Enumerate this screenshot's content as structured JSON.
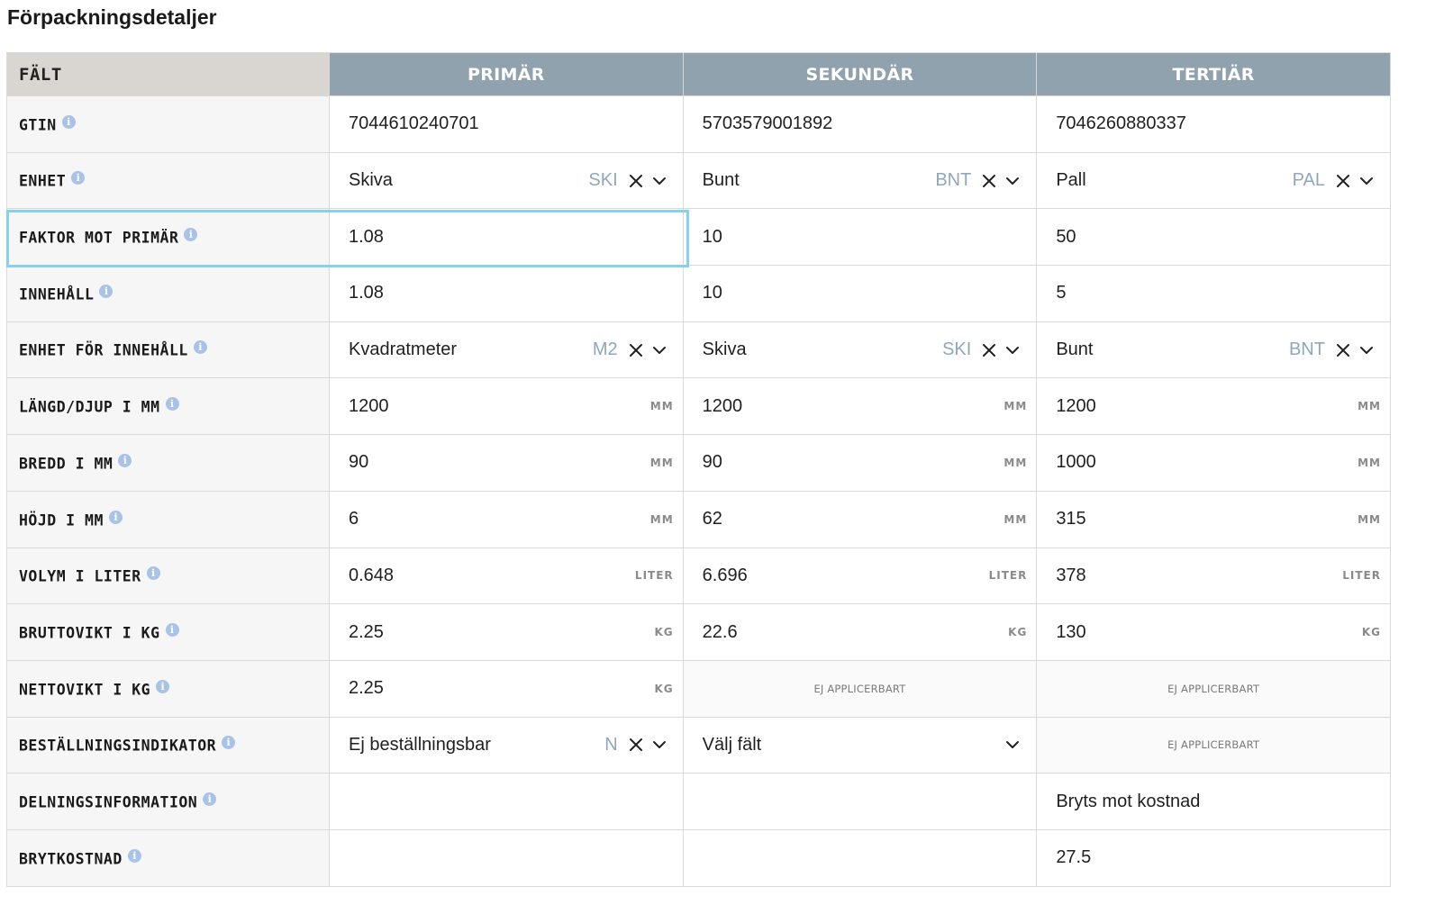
{
  "page_title": "Förpackningsdetaljer",
  "headers": {
    "field": "FÄLT",
    "primary": "PRIMÄR",
    "secondary": "SEKUNDÄR",
    "tertiary": "TERTIÄR"
  },
  "rows": [
    {
      "label": "GTIN",
      "cells": [
        {
          "kind": "text",
          "value": "7044610240701"
        },
        {
          "kind": "text",
          "value": "5703579001892"
        },
        {
          "kind": "text",
          "value": "7046260880337"
        }
      ]
    },
    {
      "label": "ENHET",
      "cells": [
        {
          "kind": "select",
          "value": "Skiva",
          "code": "SKI"
        },
        {
          "kind": "select",
          "value": "Bunt",
          "code": "BNT"
        },
        {
          "kind": "select",
          "value": "Pall",
          "code": "PAL"
        }
      ]
    },
    {
      "label": "FAKTOR MOT PRIMÄR",
      "cells": [
        {
          "kind": "text",
          "value": "1.08"
        },
        {
          "kind": "text",
          "value": "10"
        },
        {
          "kind": "text",
          "value": "50"
        }
      ]
    },
    {
      "label": "INNEHÅLL",
      "cells": [
        {
          "kind": "text",
          "value": "1.08"
        },
        {
          "kind": "text",
          "value": "10"
        },
        {
          "kind": "text",
          "value": "5"
        }
      ]
    },
    {
      "label": "ENHET FÖR INNEHÅLL",
      "cells": [
        {
          "kind": "select",
          "value": "Kvadratmeter",
          "code": "M2"
        },
        {
          "kind": "select",
          "value": "Skiva",
          "code": "SKI"
        },
        {
          "kind": "select",
          "value": "Bunt",
          "code": "BNT"
        }
      ]
    },
    {
      "label": "LÄNGD/DJUP I MM",
      "cells": [
        {
          "kind": "unit",
          "value": "1200",
          "unit": "MM"
        },
        {
          "kind": "unit",
          "value": "1200",
          "unit": "MM"
        },
        {
          "kind": "unit",
          "value": "1200",
          "unit": "MM"
        }
      ]
    },
    {
      "label": "BREDD I MM",
      "cells": [
        {
          "kind": "unit",
          "value": "90",
          "unit": "MM"
        },
        {
          "kind": "unit",
          "value": "90",
          "unit": "MM"
        },
        {
          "kind": "unit",
          "value": "1000",
          "unit": "MM"
        }
      ]
    },
    {
      "label": "HÖJD I MM",
      "cells": [
        {
          "kind": "unit",
          "value": "6",
          "unit": "MM"
        },
        {
          "kind": "unit",
          "value": "62",
          "unit": "MM"
        },
        {
          "kind": "unit",
          "value": "315",
          "unit": "MM"
        }
      ]
    },
    {
      "label": "VOLYM I LITER",
      "cells": [
        {
          "kind": "unit",
          "value": "0.648",
          "unit": "LITER"
        },
        {
          "kind": "unit",
          "value": "6.696",
          "unit": "LITER"
        },
        {
          "kind": "unit",
          "value": "378",
          "unit": "LITER"
        }
      ]
    },
    {
      "label": "BRUTTOVIKT I KG",
      "cells": [
        {
          "kind": "unit",
          "value": "2.25",
          "unit": "KG"
        },
        {
          "kind": "unit",
          "value": "22.6",
          "unit": "KG"
        },
        {
          "kind": "unit",
          "value": "130",
          "unit": "KG"
        }
      ]
    },
    {
      "label": "NETTOVIKT I KG",
      "cells": [
        {
          "kind": "unit",
          "value": "2.25",
          "unit": "KG"
        },
        {
          "kind": "na",
          "value": "EJ APPLICERBART"
        },
        {
          "kind": "na",
          "value": "EJ APPLICERBART"
        }
      ]
    },
    {
      "label": "BESTÄLLNINGSINDIKATOR",
      "cells": [
        {
          "kind": "select",
          "value": "Ej beställningsbar",
          "code": "N"
        },
        {
          "kind": "placeholder",
          "value": "Välj fält"
        },
        {
          "kind": "na",
          "value": "EJ APPLICERBART"
        }
      ]
    },
    {
      "label": "DELNINGSINFORMATION",
      "cells": [
        {
          "kind": "empty"
        },
        {
          "kind": "empty"
        },
        {
          "kind": "text",
          "value": "Bryts mot kostnad"
        }
      ]
    },
    {
      "label": "BRYTKOSTNAD",
      "cells": [
        {
          "kind": "empty"
        },
        {
          "kind": "empty"
        },
        {
          "kind": "text",
          "value": "27.5"
        }
      ]
    }
  ],
  "colors": {
    "header_blue": "#8fa2ad",
    "header_field": "#d9d6d1",
    "code_text": "#8fa7bd",
    "info_icon": "#a9c3e8",
    "focus_outline": "#86d0f1"
  },
  "icons": {
    "info": "info-icon",
    "clear": "clear-icon",
    "dropdown": "chevron-down-icon"
  }
}
